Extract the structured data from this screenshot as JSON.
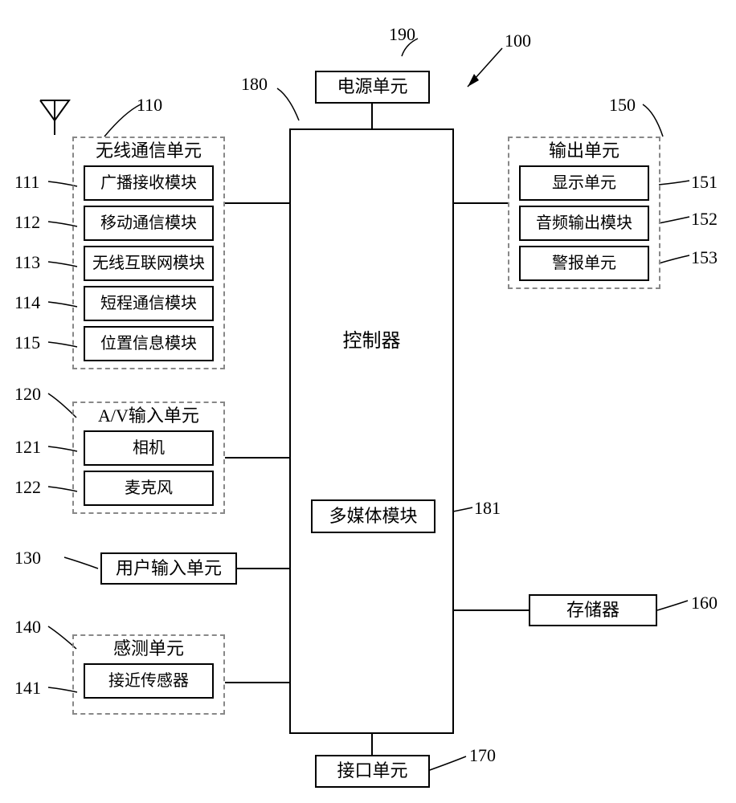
{
  "refs": {
    "system_arrow": "100",
    "power": "190",
    "controller_ref": "180",
    "wireless": "110",
    "broadcast": "111",
    "mobile_comm": "112",
    "wlan": "113",
    "short_range": "114",
    "position": "115",
    "av_input": "120",
    "camera": "121",
    "microphone": "122",
    "user_input": "130",
    "sensing": "140",
    "proximity": "141",
    "output": "150",
    "display": "151",
    "audio_out": "152",
    "alarm": "153",
    "memory": "160",
    "interface": "170",
    "multimedia": "181"
  },
  "labels": {
    "power": "电源单元",
    "controller": "控制器",
    "wireless": "无线通信单元",
    "broadcast": "广播接收模块",
    "mobile_comm": "移动通信模块",
    "wlan": "无线互联网模块",
    "short_range": "短程通信模块",
    "position": "位置信息模块",
    "av_input": "A/V输入单元",
    "camera": "相机",
    "microphone": "麦克风",
    "user_input": "用户输入单元",
    "sensing": "感测单元",
    "proximity": "接近传感器",
    "output": "输出单元",
    "display": "显示单元",
    "audio_out": "音频输出模块",
    "alarm": "警报单元",
    "memory": "存储器",
    "interface": "接口单元",
    "multimedia": "多媒体模块"
  }
}
